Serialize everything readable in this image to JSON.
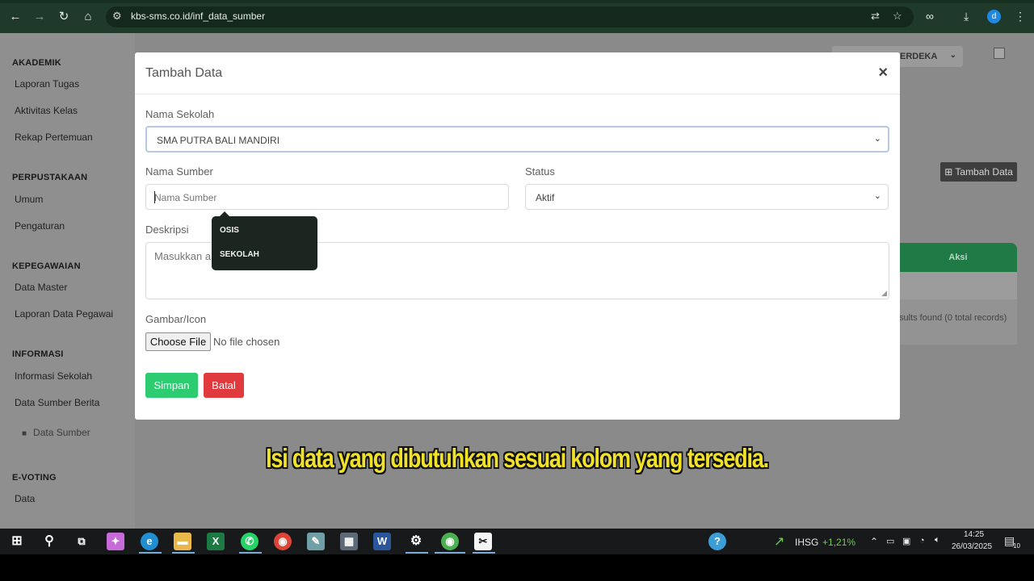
{
  "browser": {
    "url": "kbs-sms.co.id/inf_data_sumber",
    "profile_initial": "d"
  },
  "sidebar": {
    "sections": [
      {
        "title": "AKADEMIK",
        "items": [
          "Laporan Tugas",
          "Aktivitas Kelas",
          "Rekap Pertemuan"
        ]
      },
      {
        "title": "PERPUSTAKAAN",
        "items": [
          "Umum",
          "Pengaturan"
        ]
      },
      {
        "title": "KEPEGAWAIAN",
        "items": [
          "Data Master",
          "Laporan Data Pegawai"
        ]
      },
      {
        "title": "INFORMASI",
        "items": [
          "Informasi Sekolah",
          "Data Sumber Berita"
        ]
      },
      {
        "title": "E-VOTING",
        "items": [
          "Data"
        ]
      }
    ],
    "active_sub": "Data Sumber"
  },
  "background": {
    "school_select_partial": "ERDEKA",
    "tambah_data_label": "Tambah Data",
    "table_action_header": "Aksi",
    "results_text": "sults found (0 total records)"
  },
  "modal": {
    "title": "Tambah Data",
    "close": "×",
    "nama_sekolah_label": "Nama Sekolah",
    "nama_sekolah_value": "SMA PUTRA BALI MANDIRI",
    "nama_sumber_label": "Nama Sumber",
    "nama_sumber_placeholder": "Nama Sumber",
    "status_label": "Status",
    "status_value": "Aktif",
    "deskripsi_label": "Deskripsi",
    "deskripsi_placeholder": "Masukkan a",
    "gambar_label": "Gambar/Icon",
    "choose_file": "Choose File",
    "no_file": "No file chosen",
    "simpan": "Simpan",
    "batal": "Batal"
  },
  "autocomplete": {
    "options": [
      "OSIS",
      "SEKOLAH"
    ]
  },
  "subtitle": "Isi data yang dibutuhkan sesuai kolom yang tersedia.",
  "taskbar": {
    "ihsg_label": "IHSG",
    "ihsg_change": "+1,21%",
    "time": "14:25",
    "date": "26/03/2025",
    "notifications": "10"
  },
  "colors": {
    "chrome": "#1f3a2b",
    "success": "#2ecc71",
    "danger": "#e0393e",
    "subtitle": "#f0e12b"
  }
}
